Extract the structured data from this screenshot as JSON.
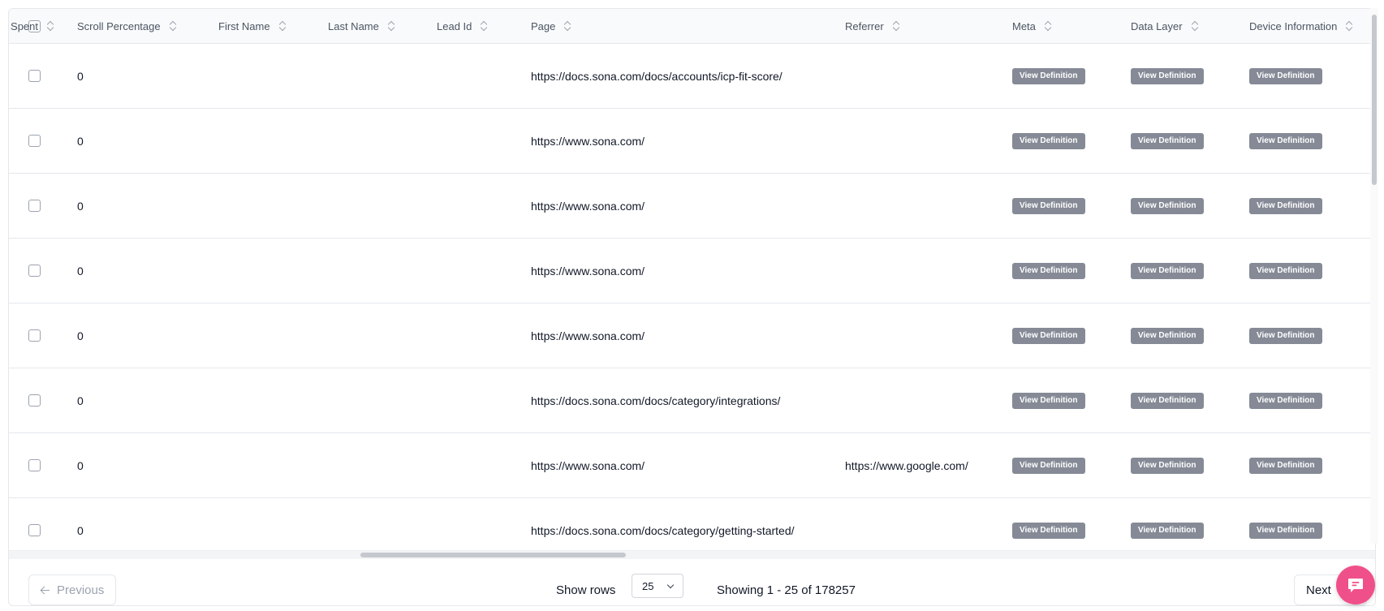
{
  "columns": [
    {
      "id": "time_spent",
      "label": "Time Spent"
    },
    {
      "id": "scroll",
      "label": "Scroll Percentage"
    },
    {
      "id": "first_name",
      "label": "First Name"
    },
    {
      "id": "last_name",
      "label": "Last Name"
    },
    {
      "id": "lead_id",
      "label": "Lead Id"
    },
    {
      "id": "page",
      "label": "Page"
    },
    {
      "id": "referrer",
      "label": "Referrer"
    },
    {
      "id": "meta",
      "label": "Meta"
    },
    {
      "id": "data_layer",
      "label": "Data Layer"
    },
    {
      "id": "device_info",
      "label": "Device Information"
    }
  ],
  "rows": [
    {
      "scroll": "0",
      "page": "https://docs.sona.com/docs/accounts/icp-fit-score/",
      "referrer": ""
    },
    {
      "scroll": "0",
      "page": "https://www.sona.com/",
      "referrer": ""
    },
    {
      "scroll": "0",
      "page": "https://www.sona.com/",
      "referrer": ""
    },
    {
      "scroll": "0",
      "page": "https://www.sona.com/",
      "referrer": ""
    },
    {
      "scroll": "0",
      "page": "https://www.sona.com/",
      "referrer": ""
    },
    {
      "scroll": "0",
      "page": "https://docs.sona.com/docs/category/integrations/",
      "referrer": ""
    },
    {
      "scroll": "0",
      "page": "https://www.sona.com/",
      "referrer": "https://www.google.com/"
    },
    {
      "scroll": "0",
      "page": "https://docs.sona.com/docs/category/getting-started/",
      "referrer": ""
    }
  ],
  "view_definition_label": "View Definition",
  "footer": {
    "previous_label": "Previous",
    "next_label": "Next",
    "show_rows_label": "Show rows",
    "rows_per_page": "25",
    "showing_text": "Showing 1 - 25 of 178257"
  },
  "icons": {
    "sort": "sort-icon",
    "arrow_left": "arrow-left-icon",
    "chevron_down": "chevron-down-icon",
    "chat": "chat-icon"
  },
  "colors": {
    "badge": "#858a96",
    "chat_button": "#f0508a"
  }
}
